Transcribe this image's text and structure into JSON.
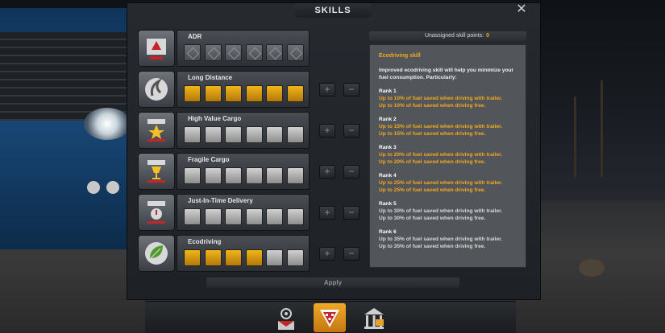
{
  "window": {
    "title": "SKILLS",
    "close_glyph": "✕"
  },
  "skills": [
    {
      "name": "ADR",
      "icon": "adr-hazard-icon",
      "ranks": 6,
      "filled": 0,
      "adr": true
    },
    {
      "name": "Long Distance",
      "icon": "long-distance-icon",
      "ranks": 6,
      "filled": 6
    },
    {
      "name": "High Value Cargo",
      "icon": "high-value-cargo-icon",
      "ranks": 6,
      "filled": 0
    },
    {
      "name": "Fragile Cargo",
      "icon": "fragile-cargo-icon",
      "ranks": 6,
      "filled": 0
    },
    {
      "name": "Just-In-Time Delivery",
      "icon": "just-in-time-icon",
      "ranks": 6,
      "filled": 0
    },
    {
      "name": "Ecodriving",
      "icon": "ecodriving-leaf-icon",
      "ranks": 6,
      "filled": 4
    }
  ],
  "controls": {
    "plus": "+",
    "minus": "−"
  },
  "unassigned": {
    "label": "Unassigned skill points:",
    "value": "0"
  },
  "info": {
    "title": "Ecodriving skill",
    "description": "Improved ecodriving skill will help you minimize your fuel consumption. Particularly:",
    "ranks": [
      {
        "title": "Rank 1",
        "line1": "Up to 10% of fuel saved when driving with trailer.",
        "line2": "Up to 10% of fuel saved when driving free.",
        "active": true
      },
      {
        "title": "Rank 2",
        "line1": "Up to 15% of fuel saved when driving with trailer.",
        "line2": "Up to 15% of fuel saved when driving free.",
        "active": true
      },
      {
        "title": "Rank 3",
        "line1": "Up to 20% of fuel saved when driving with trailer.",
        "line2": "Up to 20% of fuel saved when driving free.",
        "active": true
      },
      {
        "title": "Rank 4",
        "line1": "Up to 25% of fuel saved when driving with trailer.",
        "line2": "Up to 25% of fuel saved when driving free.",
        "active": true
      },
      {
        "title": "Rank 5",
        "line1": "Up to 30% of fuel saved when driving with trailer.",
        "line2": "Up to 30% of fuel saved when driving free.",
        "active": false
      },
      {
        "title": "Rank 6",
        "line1": "Up to 35% of fuel saved when driving with trailer.",
        "line2": "Up to 35% of fuel saved when driving free.",
        "active": false
      }
    ]
  },
  "apply_label": "Apply",
  "tabs": [
    {
      "icon": "email-icon",
      "active": false
    },
    {
      "icon": "skills-icon",
      "active": true
    },
    {
      "icon": "bank-icon",
      "active": false
    }
  ],
  "colors": {
    "accent": "#f2a81d",
    "rank_on": "#e8a515",
    "rank_off": "#b8b8b8",
    "panel": "#1f2227",
    "info_bg": "#52565b"
  }
}
